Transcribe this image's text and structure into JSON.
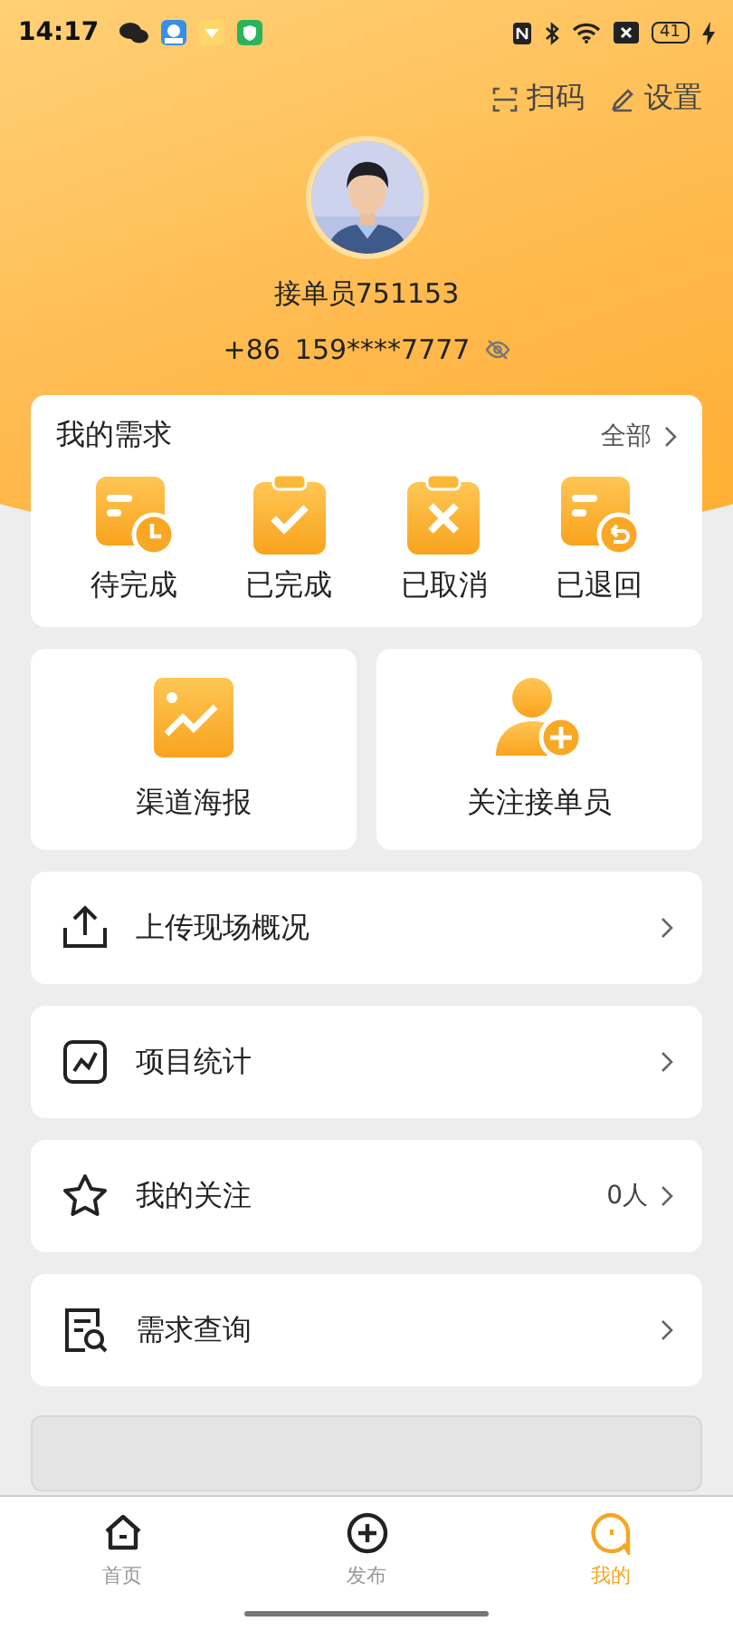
{
  "status_bar": {
    "time": "14:17",
    "battery": "41"
  },
  "header_actions": [
    {
      "kind": "scan",
      "label": "扫码"
    },
    {
      "kind": "settings",
      "label": "设置"
    }
  ],
  "profile": {
    "name": "接单员751153",
    "country_code": "+86",
    "phone": "159****7777"
  },
  "requests": {
    "title": "我的需求",
    "more": "全部",
    "items": [
      {
        "kind": "pending",
        "label": "待完成"
      },
      {
        "kind": "done",
        "label": "已完成"
      },
      {
        "kind": "cancelled",
        "label": "已取消"
      },
      {
        "kind": "returned",
        "label": "已退回"
      }
    ]
  },
  "tiles": [
    {
      "kind": "poster",
      "label": "渠道海报"
    },
    {
      "kind": "follow",
      "label": "关注接单员"
    }
  ],
  "menu": [
    {
      "kind": "upload",
      "label": "上传现场概况"
    },
    {
      "kind": "stats",
      "label": "项目统计"
    },
    {
      "kind": "follows",
      "label": "我的关注",
      "value": "0人"
    },
    {
      "kind": "query",
      "label": "需求查询"
    }
  ],
  "tab_bar": [
    {
      "kind": "home",
      "label": "首页",
      "selected": false
    },
    {
      "kind": "publish",
      "label": "发布",
      "selected": false
    },
    {
      "kind": "mine",
      "label": "我的",
      "selected": true
    }
  ]
}
